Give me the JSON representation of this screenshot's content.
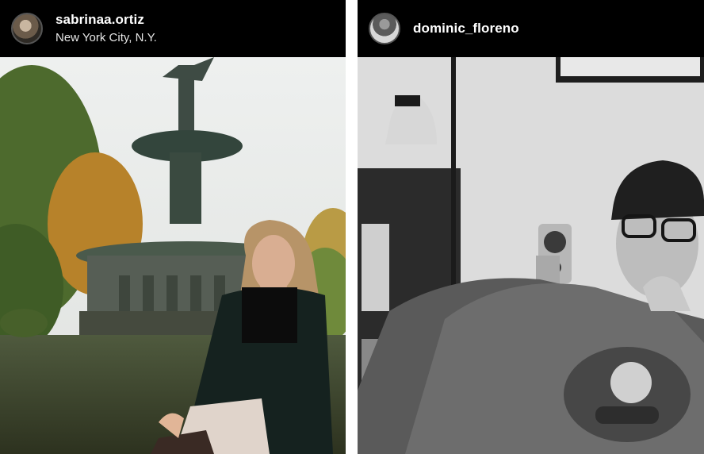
{
  "posts": [
    {
      "username": "sabrinaa.ortiz",
      "location": "New York City, N.Y.",
      "photo_subject": "woman seated at fountain"
    },
    {
      "username": "dominic_floreno",
      "photo_subject": "man in cap and sweatshirt"
    }
  ]
}
